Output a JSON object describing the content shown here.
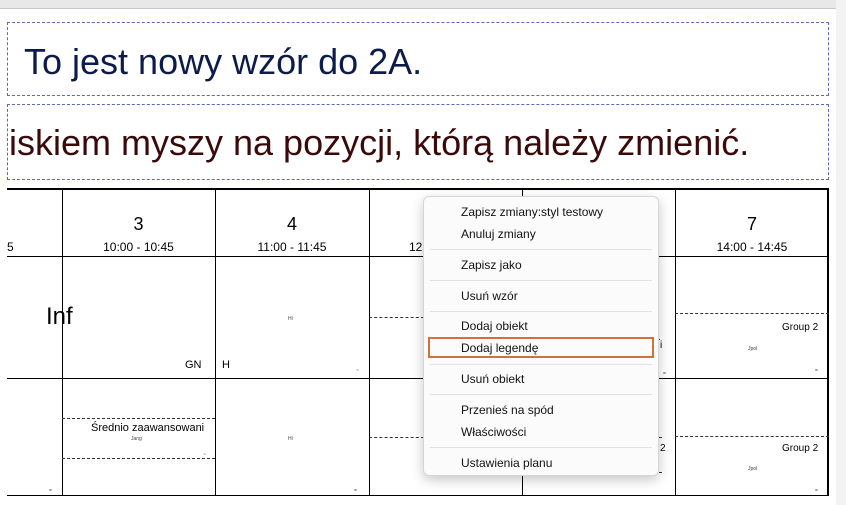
{
  "slides": {
    "title1": "To jest nowy wzór do 2A.",
    "title2": "iskiem myszy na pozycji, którą należy zmienić."
  },
  "grid": {
    "columns": [
      {
        "num": "",
        "time": "5"
      },
      {
        "num": "3",
        "time": "10:00 - 10:45"
      },
      {
        "num": "4",
        "time": "11:00 - 11:45"
      },
      {
        "num": "",
        "time": "12"
      },
      {
        "num": "",
        "time": ""
      },
      {
        "num": "7",
        "time": "14:00 - 14:45"
      }
    ],
    "cells": {
      "inf": "Inf",
      "gn": "GN",
      "h": "H",
      "hi_top": "Hi",
      "hi_bottom": "Hi",
      "sredn": "Średnio zaawansowani",
      "jang": "Jang",
      "group2_top": "Group 2",
      "group2_bottom": "Group 2",
      "jpol_top": "Jpol",
      "jpol_bottom": "Jpol",
      "frag_i": "i",
      "frag_2": "2"
    }
  },
  "context_menu": {
    "items": [
      {
        "label": "Zapisz zmiany:styl testowy"
      },
      {
        "label": "Anuluj zmiany"
      },
      {
        "label": "Zapisz jako"
      },
      {
        "label": "Usuń wzór"
      },
      {
        "label": "Dodaj obiekt"
      },
      {
        "label": "Dodaj legendę"
      },
      {
        "label": "Usuń obiekt"
      },
      {
        "label": "Przenieś na spód"
      },
      {
        "label": "Właściwości"
      },
      {
        "label": "Ustawienia planu"
      }
    ],
    "highlighted": "Dodaj legendę",
    "highlight_color": "#d0723a"
  }
}
